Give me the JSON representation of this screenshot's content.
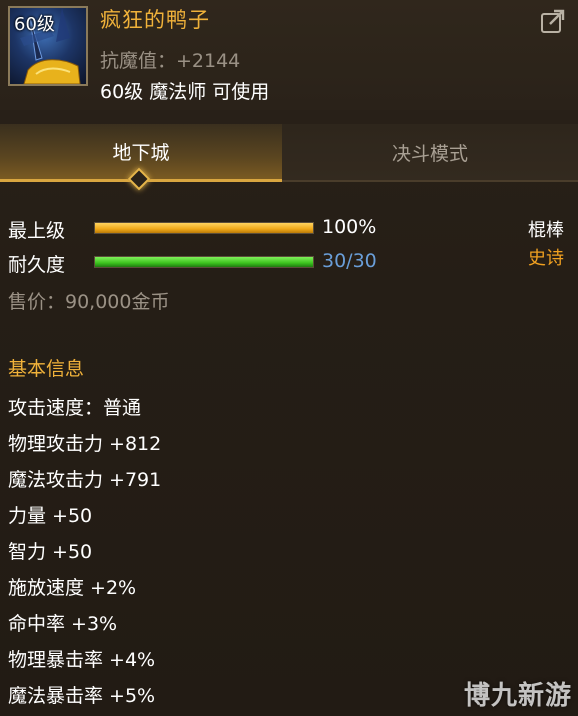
{
  "item": {
    "level_badge": "60级",
    "name": "疯狂的鸭子",
    "resist": "抗魔值：+2144",
    "requirement": "60级 魔法师 可使用",
    "icon": "duck-weapon-icon"
  },
  "tabs": [
    {
      "label": "地下城",
      "active": true
    },
    {
      "label": "决斗模式",
      "active": false
    }
  ],
  "upgrade": {
    "label": "最上级",
    "value_text": "100%",
    "fraction": 1.0,
    "color": "#f0a818"
  },
  "durability": {
    "label": "耐久度",
    "value_text": "30/30",
    "fraction": 1.0,
    "color": "#3cc31e",
    "value_color": "#6a9ed8"
  },
  "weapon_type": "棍棒",
  "rarity": {
    "text": "史诗",
    "color": "#f0a020"
  },
  "price": "售价：90,000金币",
  "basic_info": {
    "title": "基本信息",
    "stats": [
      "攻击速度：普通",
      "物理攻击力 +812",
      "魔法攻击力 +791",
      "力量 +50",
      "智力 +50",
      "施放速度 +2%",
      "命中率 +3%",
      "物理暴击率 +4%",
      "魔法暴击率 +5%"
    ]
  },
  "watermark": "博九新游",
  "colors": {
    "gold": "#f0b23a",
    "gray": "#9a9185",
    "background": "#241d16"
  }
}
